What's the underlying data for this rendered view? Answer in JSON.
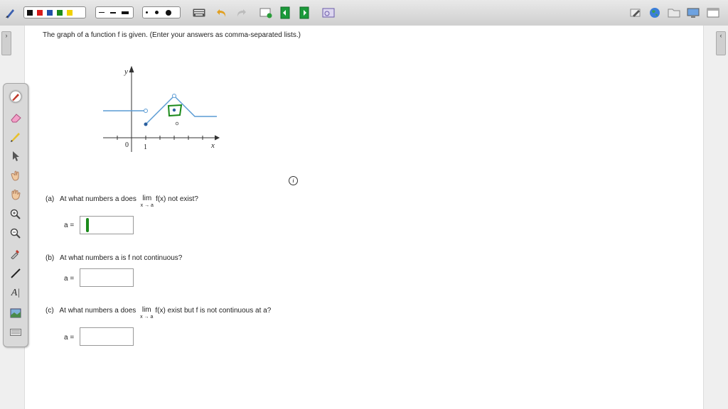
{
  "question": {
    "intro": "The graph of a function f is given. (Enter your answers as comma-separated lists.)",
    "part_a": {
      "label": "(a)",
      "text_before": "At what numbers a does",
      "lim_top": "lim",
      "lim_sub": "x → a",
      "text_after": "f(x) not exist?",
      "eq": "a =",
      "value": ""
    },
    "part_b": {
      "label": "(b)",
      "text": "At what numbers a is f not continuous?",
      "eq": "a =",
      "value": ""
    },
    "part_c": {
      "label": "(c)",
      "text_before": "At what numbers a does",
      "lim_top": "lim",
      "lim_sub": "x → a",
      "text_after": "f(x) exist but f is not continuous at a?",
      "eq": "a =",
      "value": ""
    }
  },
  "graph": {
    "y_label": "y",
    "x_label": "x",
    "origin_label": "0",
    "tick_label": "1"
  },
  "info_icon": "i",
  "toolbar": {
    "colors": [
      "#111111",
      "#d81b1b",
      "#1f4fa8",
      "#1b8a1b",
      "#f0d000"
    ],
    "icons": [
      "pen-menu-icon",
      "keyboard-icon",
      "undo-icon",
      "redo-icon",
      "add-page-icon",
      "insert-page-icon",
      "next-page-icon",
      "screen-capture-icon",
      "edit-icon",
      "globe-icon",
      "folder-icon",
      "display-icon",
      "window-icon"
    ]
  },
  "palette": {
    "tools": [
      "pen-icon",
      "eraser-icon",
      "highlighter-icon",
      "pointer-icon",
      "hand-pan-icon",
      "hand-grab-icon",
      "zoom-in-icon",
      "zoom-out-icon",
      "eyedropper-icon",
      "line-icon",
      "text-tool-icon",
      "screenshot-icon",
      "keyboard-icon"
    ],
    "text_tool_label": "A|"
  },
  "accent_green": "#1b8a1b",
  "graph_color": "#5a9bd4"
}
